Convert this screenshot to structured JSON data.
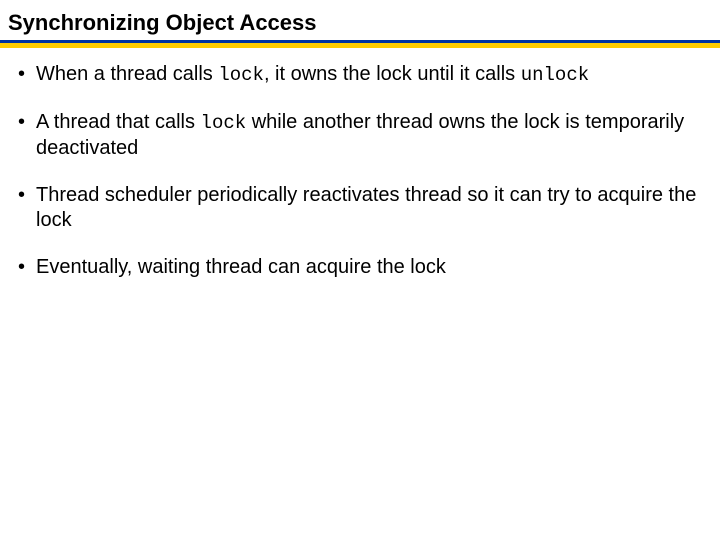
{
  "title": "Synchronizing Object Access",
  "bullets": [
    {
      "pre": "When a thread calls ",
      "code1": "lock",
      "mid": ", it owns the lock until it calls ",
      "code2": "unlock",
      "post": ""
    },
    {
      "pre": "A thread that calls ",
      "code1": "lock",
      "mid": " while another thread owns the lock is temporarily deactivated",
      "code2": "",
      "post": ""
    },
    {
      "pre": "Thread scheduler periodically reactivates thread so it can try to acquire the lock",
      "code1": "",
      "mid": "",
      "code2": "",
      "post": ""
    },
    {
      "pre": "Eventually, waiting thread can acquire the lock",
      "code1": "",
      "mid": "",
      "code2": "",
      "post": ""
    }
  ]
}
